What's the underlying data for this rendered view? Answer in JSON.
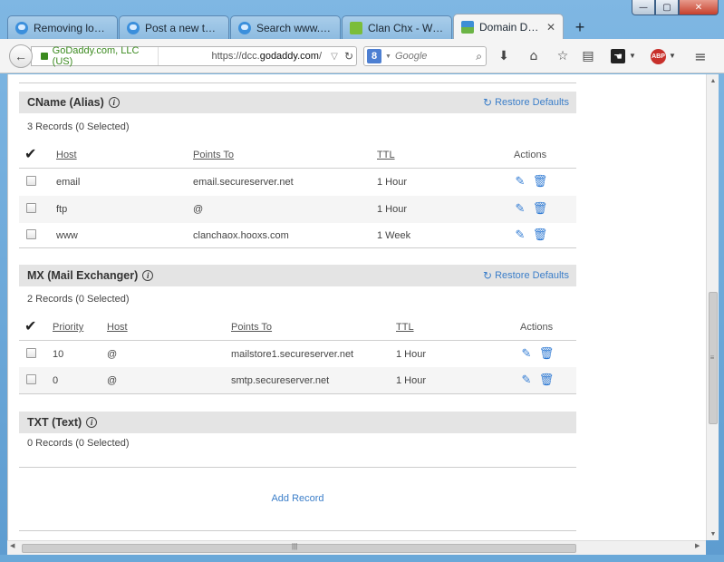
{
  "window": {
    "min_glyph": "—",
    "max_glyph": "▢",
    "close_glyph": "✕"
  },
  "tabs": [
    {
      "label": "Removing login...",
      "icon": "chat-bubble-icon",
      "active": false
    },
    {
      "label": "Post a new topic",
      "icon": "chat-bubble-icon",
      "active": false
    },
    {
      "label": "Search www.ch...",
      "icon": "chat-bubble-icon",
      "active": false
    },
    {
      "label": "Clan Chx - Welc...",
      "icon": "clan-icon",
      "active": false
    },
    {
      "label": "Domain Det...",
      "icon": "godaddy-icon",
      "active": true
    }
  ],
  "new_tab_glyph": "+",
  "navbar": {
    "identity": "GoDaddy.com, LLC (US)",
    "url_prefix": "https://dcc.",
    "url_domain": "godaddy.com",
    "url_suffix": "/",
    "search_placeholder": "Google",
    "search_engine_glyph": "8"
  },
  "sections": {
    "cname": {
      "title": "CName (Alias)",
      "restore_label": "Restore Defaults",
      "count": "3 Records (0 Selected)",
      "headers": {
        "host": "Host",
        "points_to": "Points To",
        "ttl": "TTL",
        "actions": "Actions"
      },
      "rows": [
        {
          "host": "email",
          "points_to": "email.secureserver.net",
          "ttl": "1 Hour"
        },
        {
          "host": "ftp",
          "points_to": "@",
          "ttl": "1 Hour"
        },
        {
          "host": "www",
          "points_to": "clanchaox.hooxs.com",
          "ttl": "1 Week"
        }
      ]
    },
    "mx": {
      "title": "MX (Mail Exchanger)",
      "restore_label": "Restore Defaults",
      "count": "2 Records (0 Selected)",
      "headers": {
        "priority": "Priority",
        "host": "Host",
        "points_to": "Points To",
        "ttl": "TTL",
        "actions": "Actions"
      },
      "rows": [
        {
          "priority": "10",
          "host": "@",
          "points_to": "mailstore1.secureserver.net",
          "ttl": "1 Hour"
        },
        {
          "priority": "0",
          "host": "@",
          "points_to": "smtp.secureserver.net",
          "ttl": "1 Hour"
        }
      ]
    },
    "txt": {
      "title": "TXT (Text)",
      "count": "0 Records (0 Selected)"
    }
  },
  "add_record_label": "Add Record",
  "colors": {
    "link": "#3b7ec9",
    "action_icon": "#2f7ad3",
    "section_bg": "#e4e4e4"
  }
}
